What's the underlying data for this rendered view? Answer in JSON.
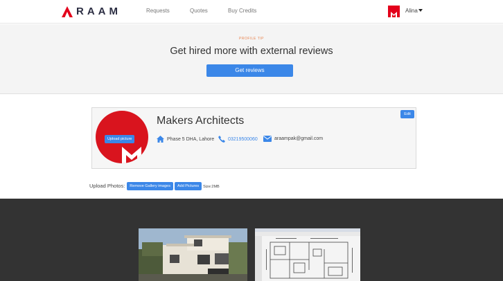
{
  "brand": {
    "logo_text": "RAAM"
  },
  "nav": {
    "links": [
      "Requests",
      "Quotes",
      "Buy Credits"
    ],
    "user_name": "Alina"
  },
  "tip": {
    "eyebrow": "PROFILE TIP",
    "title": "Get hired more with external reviews",
    "button": "Get reviews"
  },
  "profile": {
    "company": "Makers Architects",
    "upload_picture": "Upload picture",
    "edit": "Edit",
    "address": "Phase 5 DHA, Lahore",
    "phone": "03219500060",
    "email": "araampak@gmail.com"
  },
  "photos": {
    "label": "Upload Photos:",
    "remove_button": "Remove Gallery images",
    "add_button": "Add Pictures",
    "size_note": "Size:2MB"
  },
  "colors": {
    "accent": "#3b87e8",
    "brand_red": "#e3001b",
    "dark_bg": "#333333"
  },
  "icons": [
    "home-icon",
    "phone-icon",
    "envelope-icon",
    "caret-down-icon"
  ]
}
